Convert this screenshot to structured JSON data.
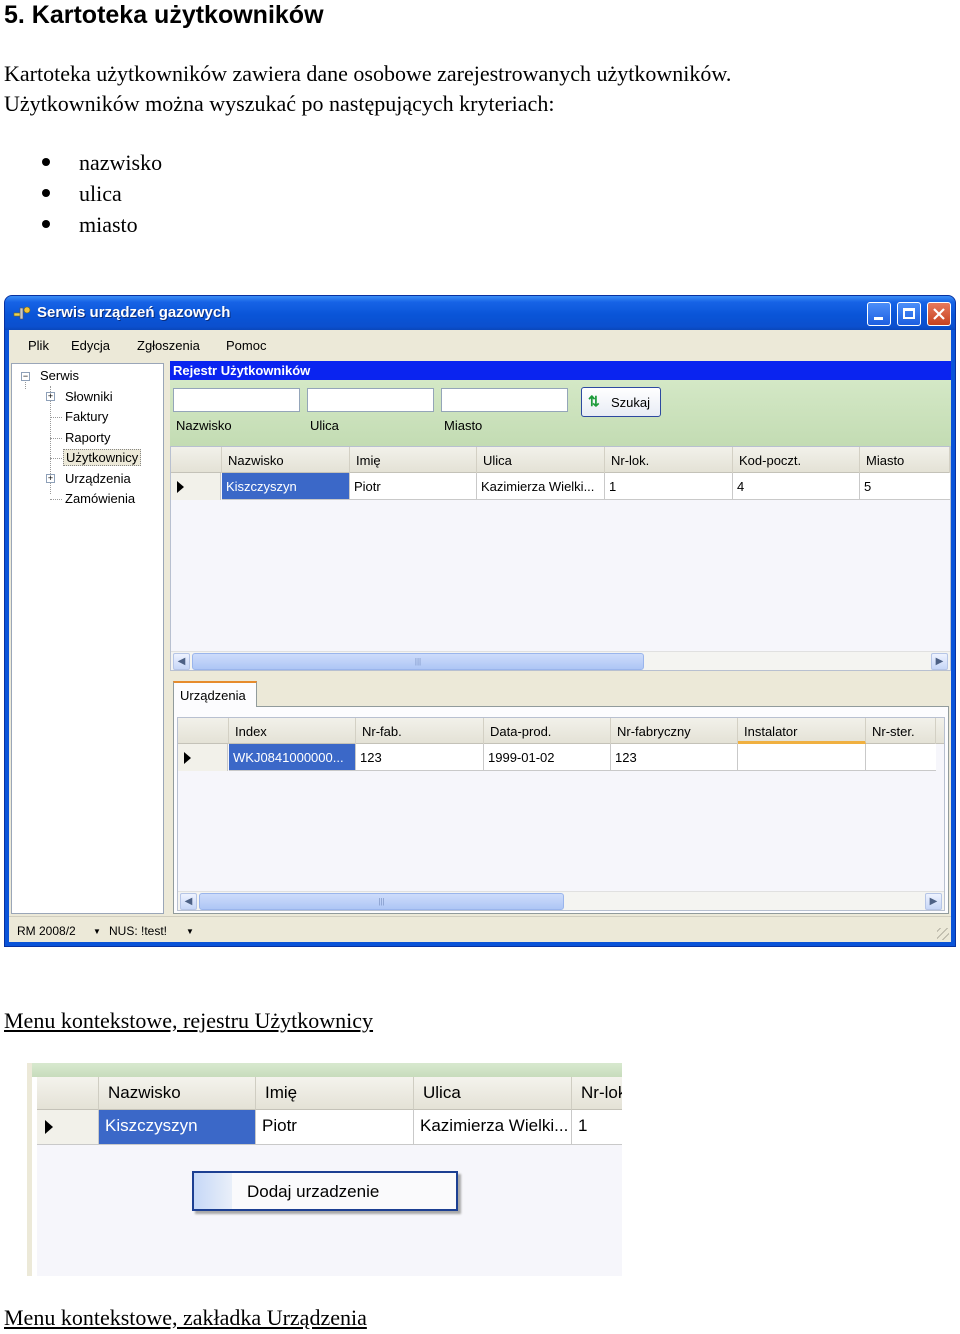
{
  "doc": {
    "heading": "5. Kartoteka użytkowników",
    "para1": "Kartoteka użytkowników zawiera dane osobowe zarejestrowanych użytkowników.",
    "para2": "Użytkowników można wyszukać po następujących kryteriach:",
    "criteria": [
      "nazwisko",
      "ulica",
      "miasto"
    ],
    "caption1": "Menu kontekstowe, rejestru Użytkownicy",
    "caption2": "Menu kontekstowe, zakładka Urządzenia"
  },
  "window": {
    "title": "Serwis urządzeń gazowych",
    "menu": [
      "Plik",
      "Edycja",
      "Zgłoszenia",
      "Pomoc"
    ],
    "tree": {
      "root": "Serwis",
      "items": [
        "Słowniki",
        "Faktury",
        "Raporty",
        "Użytkownicy",
        "Urządzenia",
        "Zamówienia"
      ],
      "selected": "Użytkownicy"
    },
    "register_title": "Rejestr Użytkowników",
    "filter": {
      "labels": [
        "Nazwisko",
        "Ulica",
        "Miasto"
      ],
      "values": [
        "",
        "",
        ""
      ],
      "search_label": "Szukaj"
    },
    "users_grid": {
      "columns": [
        "Nazwisko",
        "Imię",
        "Ulica",
        "Nr-lok.",
        "Kod-poczt.",
        "Miasto"
      ],
      "rows": [
        [
          "Kiszczyszyn",
          "Piotr",
          "Kazimierza Wielki...",
          "1",
          "4",
          "5"
        ]
      ]
    },
    "tab_label": "Urządzenia",
    "devices_grid": {
      "columns": [
        "Index",
        "Nr-fab.",
        "Data-prod.",
        "Nr-fabryczny",
        "Instalator",
        "Nr-ster."
      ],
      "rows": [
        [
          "WKJ0841000000...",
          "123",
          "1999-01-02",
          "123",
          "",
          ""
        ]
      ]
    },
    "status": [
      "RM 2008/2",
      "NUS: !test!"
    ]
  },
  "context_snippet": {
    "columns": [
      "Nazwisko",
      "Imię",
      "Ulica",
      "Nr-lok"
    ],
    "row": [
      "Kiszczyszyn",
      "Piotr",
      "Kazimierza Wielki...",
      "1"
    ],
    "menu_item": "Dodaj urzadzenie"
  },
  "colors": {
    "titlebar": "#0a55d8",
    "register_header": "#0a24f0",
    "selection": "#3b68c8",
    "filter_bg": "#c3dcb3",
    "window_face": "#ece9d8"
  }
}
